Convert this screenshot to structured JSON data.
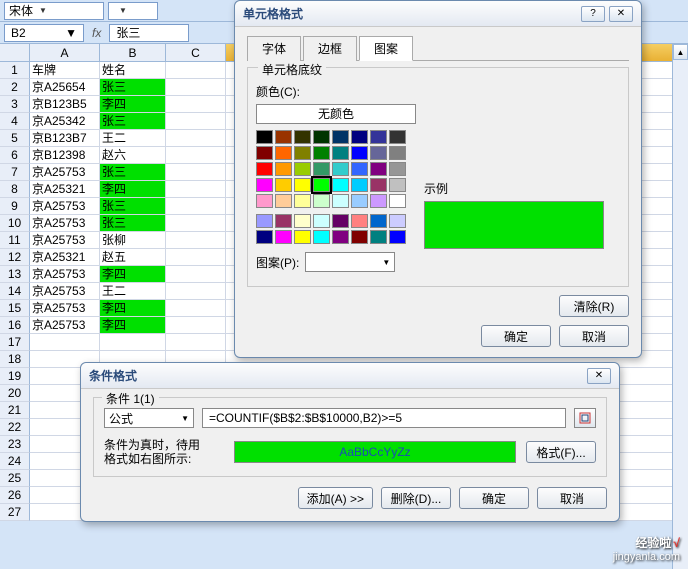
{
  "topbar": {
    "font_style": "宋体",
    "fontsize": ""
  },
  "formula_bar": {
    "cell_ref": "B2",
    "fx_label": "fx",
    "value": "张三"
  },
  "columns": [
    "A",
    "B",
    "C"
  ],
  "headers": {
    "A": "车牌",
    "B": "姓名"
  },
  "rows": [
    {
      "n": 1,
      "A": "车牌",
      "B": "姓名",
      "hl": false
    },
    {
      "n": 2,
      "A": "京A25654",
      "B": "张三",
      "hl": true
    },
    {
      "n": 3,
      "A": "京B123B5",
      "B": "李四",
      "hl": true
    },
    {
      "n": 4,
      "A": "京A25342",
      "B": "张三",
      "hl": true
    },
    {
      "n": 5,
      "A": "京B123B7",
      "B": "王二",
      "hl": false
    },
    {
      "n": 6,
      "A": "京B12398",
      "B": "赵六",
      "hl": false
    },
    {
      "n": 7,
      "A": "京A25753",
      "B": "张三",
      "hl": true
    },
    {
      "n": 8,
      "A": "京A25321",
      "B": "李四",
      "hl": true
    },
    {
      "n": 9,
      "A": "京A25753",
      "B": "张三",
      "hl": true
    },
    {
      "n": 10,
      "A": "京A25753",
      "B": "张三",
      "hl": true
    },
    {
      "n": 11,
      "A": "京A25753",
      "B": "张柳",
      "hl": false
    },
    {
      "n": 12,
      "A": "京A25321",
      "B": "赵五",
      "hl": false
    },
    {
      "n": 13,
      "A": "京A25753",
      "B": "李四",
      "hl": true
    },
    {
      "n": 14,
      "A": "京A25753",
      "B": "王二",
      "hl": false
    },
    {
      "n": 15,
      "A": "京A25753",
      "B": "李四",
      "hl": true
    },
    {
      "n": 16,
      "A": "京A25753",
      "B": "李四",
      "hl": true
    },
    {
      "n": 17,
      "A": "",
      "B": "",
      "hl": false
    },
    {
      "n": 18,
      "A": "",
      "B": "",
      "hl": false
    },
    {
      "n": 19,
      "A": "",
      "B": "",
      "hl": false
    },
    {
      "n": 20,
      "A": "",
      "B": "",
      "hl": false
    },
    {
      "n": 21,
      "A": "",
      "B": "",
      "hl": false
    },
    {
      "n": 22,
      "A": "",
      "B": "",
      "hl": false
    },
    {
      "n": 23,
      "A": "",
      "B": "",
      "hl": false
    },
    {
      "n": 24,
      "A": "",
      "B": "",
      "hl": false
    },
    {
      "n": 25,
      "A": "",
      "B": "",
      "hl": false
    },
    {
      "n": 26,
      "A": "",
      "B": "",
      "hl": false
    },
    {
      "n": 27,
      "A": "",
      "B": "",
      "hl": false
    }
  ],
  "format_dialog": {
    "title": "单元格格式",
    "tabs": {
      "font": "字体",
      "border": "边框",
      "pattern": "图案"
    },
    "group_label": "单元格底纹",
    "color_label": "颜色(C):",
    "no_color": "无颜色",
    "pattern_label": "图案(P):",
    "example_label": "示例",
    "clear": "清除(R)",
    "ok": "确定",
    "cancel": "取消",
    "palette_main": [
      [
        "#000000",
        "#993300",
        "#333300",
        "#003300",
        "#003366",
        "#000080",
        "#333399",
        "#333333"
      ],
      [
        "#800000",
        "#ff6600",
        "#808000",
        "#008000",
        "#008080",
        "#0000ff",
        "#666699",
        "#808080"
      ],
      [
        "#ff0000",
        "#ff9900",
        "#99cc00",
        "#339966",
        "#33cccc",
        "#3366ff",
        "#800080",
        "#969696"
      ],
      [
        "#ff00ff",
        "#ffcc00",
        "#ffff00",
        "#00ff00",
        "#00ffff",
        "#00ccff",
        "#993366",
        "#c0c0c0"
      ],
      [
        "#ff99cc",
        "#ffcc99",
        "#ffff99",
        "#ccffcc",
        "#ccffff",
        "#99ccff",
        "#cc99ff",
        "#ffffff"
      ]
    ],
    "palette_extra": [
      [
        "#9999ff",
        "#993366",
        "#ffffcc",
        "#ccffff",
        "#660066",
        "#ff8080",
        "#0066cc",
        "#ccccff"
      ],
      [
        "#000080",
        "#ff00ff",
        "#ffff00",
        "#00ffff",
        "#800080",
        "#800000",
        "#008080",
        "#0000ff"
      ]
    ],
    "selected_color": "#00ff00"
  },
  "cond_dialog": {
    "title": "条件格式",
    "group_label": "条件 1(1)",
    "rule_type": "公式",
    "formula": "=COUNTIF($B$2:$B$10000,B2)>=5",
    "desc": "条件为真时，待用\n格式如右图所示:",
    "preview_text": "AaBbCcYyZz",
    "format_btn": "格式(F)...",
    "add": "添加(A) >>",
    "delete": "删除(D)...",
    "ok": "确定",
    "cancel": "取消"
  },
  "watermark": {
    "line1": "经验啦",
    "line2": "jingyanla.com"
  }
}
